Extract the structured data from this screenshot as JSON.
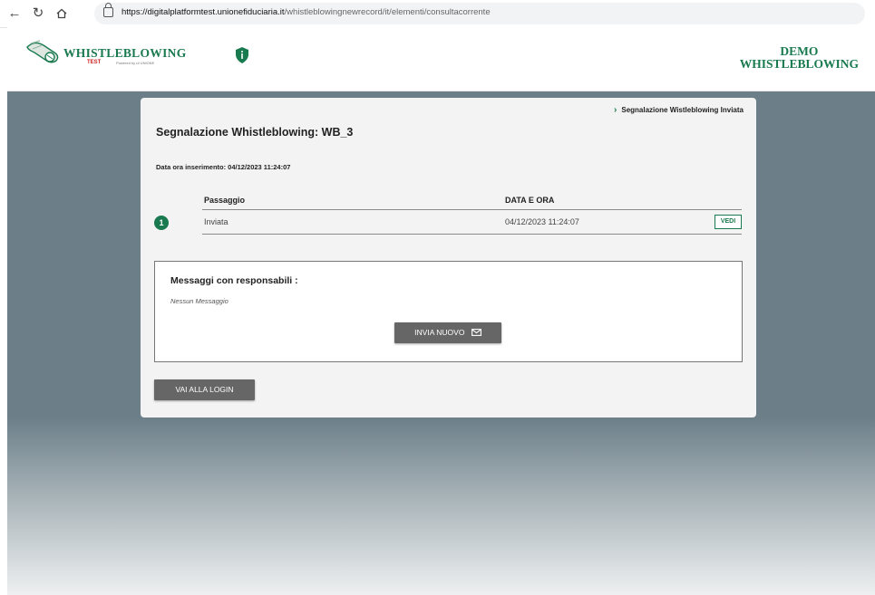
{
  "browser": {
    "url_host": "https://digitalplatformtest.unionefiduciaria.it",
    "url_path": "/whistleblowingnewrecord/it/elementi/consultacorrente"
  },
  "header": {
    "logo_title": "WHISTLEBLOWING",
    "logo_subtitle": "TEST",
    "logo_powered": "Powered by uf UNIONE",
    "demo_title_line1": "DEMO",
    "demo_title_line2": "WHISTLEBLOWING"
  },
  "card": {
    "breadcrumb": "Segnalazione Wistleblowing Inviata",
    "title": "Segnalazione Whistleblowing: WB_3",
    "insert_date": "Data ora inserimento: 04/12/2023 11:24:07",
    "table": {
      "col_step": "Passaggio",
      "col_datetime": "DATA E ORA",
      "rows": [
        {
          "number": "1",
          "step": "Inviata",
          "datetime": "04/12/2023 11:24:07",
          "action": "VEDI"
        }
      ]
    },
    "messages": {
      "title": "Messaggi con responsabili :",
      "empty": "Nessun Messaggio",
      "new_button": "INVIA NUOVO"
    },
    "login_button": "VAI ALLA LOGIN"
  },
  "colors": {
    "brand_green": "#1a7a4f",
    "button_gray": "#666666",
    "background_slate": "#6c7f89"
  },
  "icons": [
    "back-arrow-icon",
    "refresh-icon",
    "home-icon",
    "lock-icon",
    "shield-icon",
    "chevron-right-icon",
    "envelope-icon"
  ]
}
